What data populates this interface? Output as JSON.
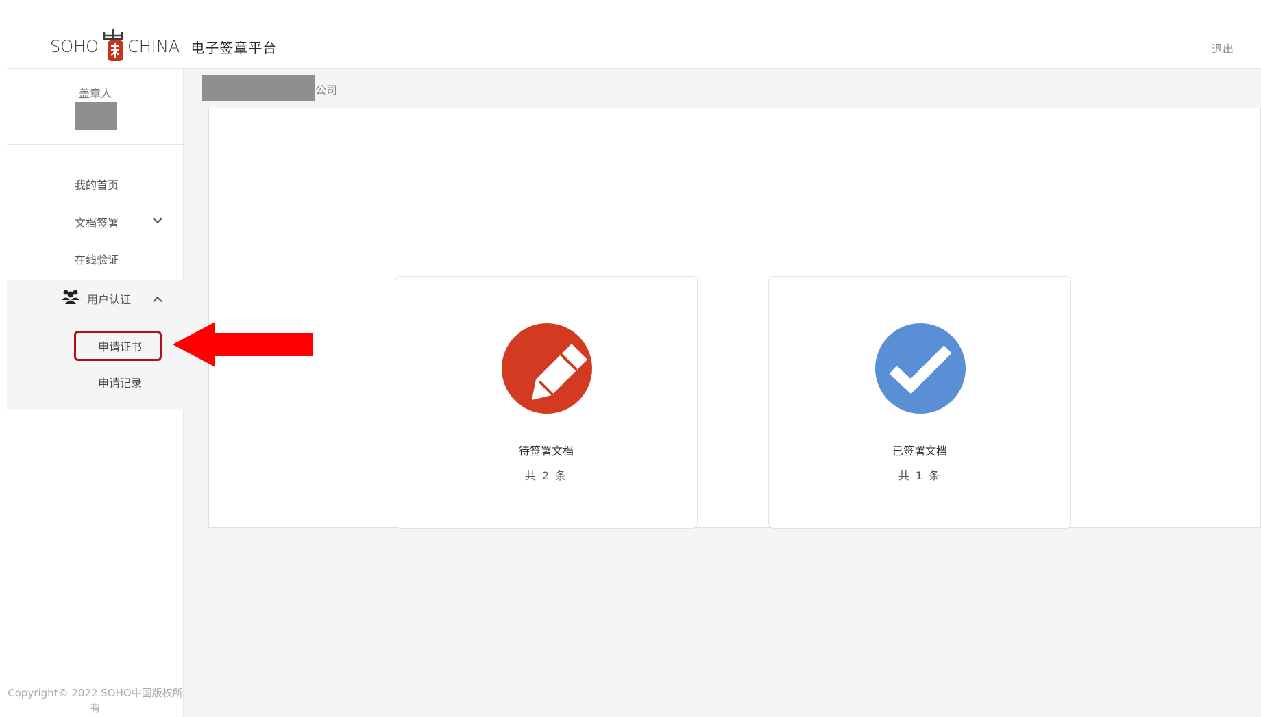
{
  "header": {
    "brand_left": "SOHO",
    "brand_right": "CHINA",
    "platform_name": "电子签章平台",
    "logout_label": "退出"
  },
  "sidebar": {
    "stamper_label": "盖章人",
    "nav": [
      {
        "label": "我的首页"
      },
      {
        "label": "文档签署"
      },
      {
        "label": "在线验证"
      },
      {
        "label": "用户认证"
      }
    ],
    "submenu": [
      {
        "label": "申请证书"
      },
      {
        "label": "申请记录"
      }
    ],
    "copyright": "Copyright© 2022 SOHO中国版权所有"
  },
  "main": {
    "company_suffix": "公司",
    "cards": [
      {
        "title": "待签署文档",
        "count": "共 2 条",
        "icon": "pencil-icon",
        "color": "#d33a22"
      },
      {
        "title": "已签署文档",
        "count": "共 1 条",
        "icon": "check-icon",
        "color": "#5a8fd6"
      }
    ]
  },
  "annotation": {
    "arrow_color": "#ff0000",
    "highlight_color": "#b0121b"
  }
}
